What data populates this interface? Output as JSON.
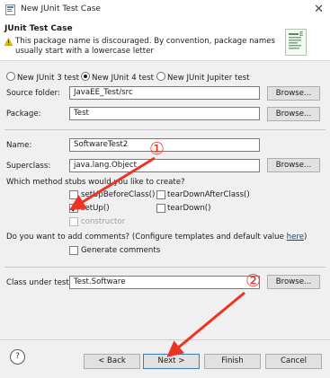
{
  "window": {
    "title": "New JUnit Test Case",
    "close_glyph": "✕"
  },
  "header": {
    "title": "JUnit Test Case",
    "warning": "This package name is discouraged. By convention, package names usually start with a lowercase letter"
  },
  "junit_version": {
    "options": [
      "New JUnit 3 test",
      "New JUnit 4 test",
      "New JUnit Jupiter test"
    ],
    "selected": "New JUnit 4 test"
  },
  "form": {
    "source_folder": {
      "label": "Source folder:",
      "value": "JavaEE_Test/src",
      "button": "Browse..."
    },
    "package": {
      "label": "Package:",
      "value": "Test",
      "button": "Browse..."
    },
    "name": {
      "label": "Name:",
      "value": "SoftwareTest2"
    },
    "superclass": {
      "label": "Superclass:",
      "value": "java.lang.Object",
      "button": "Browse..."
    }
  },
  "stubs": {
    "question": "Which method stubs would you like to create?",
    "setUpBeforeClass": {
      "label": "setUpBeforeClass()",
      "checked": false
    },
    "tearDownAfterClass": {
      "label": "tearDownAfterClass()",
      "checked": false
    },
    "setUp": {
      "label": "setUp()",
      "checked": true
    },
    "tearDown": {
      "label": "tearDown()",
      "checked": false
    },
    "constructor": {
      "label": "constructor",
      "checked": false,
      "enabled": false
    }
  },
  "comments": {
    "question": "Do you want to add comments? (Configure templates and default value",
    "link": "here",
    "close_paren": ")",
    "generate": {
      "label": "Generate comments",
      "checked": false
    }
  },
  "class_under_test": {
    "label": "Class under test:",
    "value": "Test.Software",
    "button": "Browse..."
  },
  "footer": {
    "help": "?",
    "back": "< Back",
    "next": "Next >",
    "finish": "Finish",
    "cancel": "Cancel"
  },
  "annotations": {
    "marker1": "①",
    "marker2": "②",
    "color": "#ee3322"
  }
}
